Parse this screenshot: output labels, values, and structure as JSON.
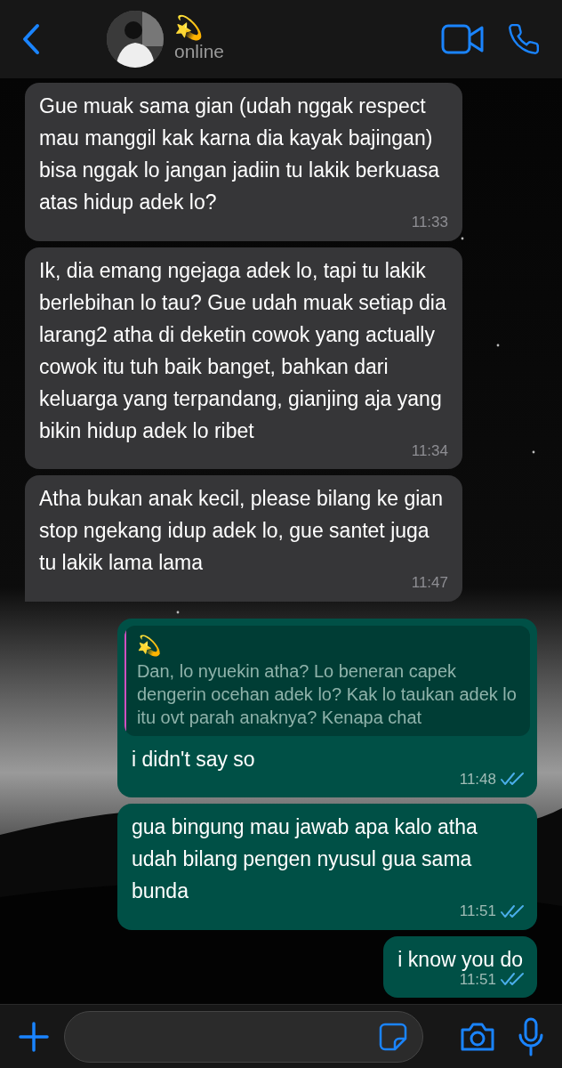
{
  "header": {
    "contact_name": "💫",
    "status": "online"
  },
  "messages": [
    {
      "kind": "incoming",
      "text": "Gue muak sama gian (udah nggak respect mau manggil kak karna dia kayak bajingan) bisa nggak lo jangan jadiin tu lakik berkuasa atas hidup adek lo?",
      "time": "11:33",
      "tail": false
    },
    {
      "kind": "incoming",
      "text": "Ik, dia emang ngejaga adek lo, tapi tu lakik berlebihan lo tau? Gue udah muak setiap dia larang2 atha di deketin cowok yang actually cowok itu tuh baik banget, bahkan dari keluarga yang terpandang, gianjing aja yang bikin hidup adek lo ribet",
      "time": "11:34",
      "tail": false
    },
    {
      "kind": "incoming",
      "text": "Atha bukan anak kecil, please bilang ke gian stop ngekang idup adek lo, gue santet juga tu lakik lama lama",
      "time": "11:47",
      "tail": true
    },
    {
      "kind": "outgoing",
      "quote": {
        "author": "💫",
        "text": "Dan, lo nyuekin atha? Lo beneran capek dengerin ocehan adek lo? Kak lo taukan adek lo itu ovt parah anaknya? Kenapa chat"
      },
      "text": "i didn't say so",
      "time": "11:48",
      "read": true
    },
    {
      "kind": "outgoing",
      "text": "gua bingung mau jawab apa kalo atha udah bilang pengen nyusul gua sama bunda",
      "time": "11:51",
      "read": true
    },
    {
      "kind": "outgoing",
      "text": "i know you do",
      "time": "11:51",
      "read": true
    }
  ]
}
